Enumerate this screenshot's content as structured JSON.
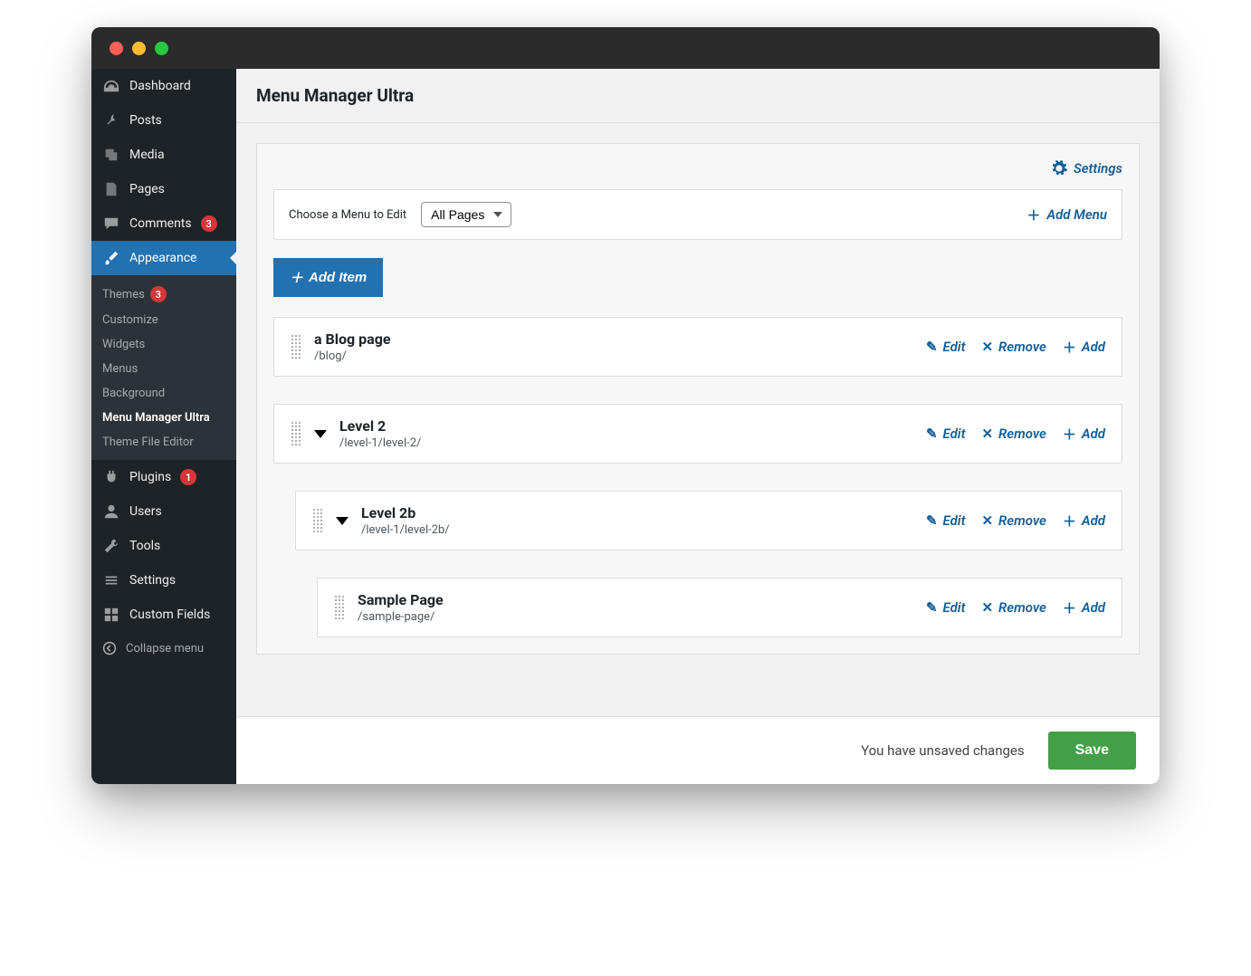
{
  "sidebar": {
    "items": [
      {
        "label": "Dashboard",
        "icon": "dashboard"
      },
      {
        "label": "Posts",
        "icon": "pin"
      },
      {
        "label": "Media",
        "icon": "media"
      },
      {
        "label": "Pages",
        "icon": "pages"
      },
      {
        "label": "Comments",
        "icon": "comment",
        "badge": "3"
      },
      {
        "label": "Appearance",
        "icon": "brush",
        "active": true
      },
      {
        "label": "Plugins",
        "icon": "plug",
        "badge": "1"
      },
      {
        "label": "Users",
        "icon": "user"
      },
      {
        "label": "Tools",
        "icon": "wrench"
      },
      {
        "label": "Settings",
        "icon": "sliders"
      },
      {
        "label": "Custom Fields",
        "icon": "grid"
      }
    ],
    "submenu": [
      {
        "label": "Themes",
        "badge": "3"
      },
      {
        "label": "Customize"
      },
      {
        "label": "Widgets"
      },
      {
        "label": "Menus"
      },
      {
        "label": "Background"
      },
      {
        "label": "Menu Manager Ultra",
        "current": true
      },
      {
        "label": "Theme File Editor"
      }
    ],
    "collapse": "Collapse menu"
  },
  "page": {
    "title": "Menu Manager Ultra",
    "settings_label": "Settings",
    "choose_menu_label": "Choose a Menu to Edit",
    "menu_select_value": "All Pages",
    "add_menu_label": "Add Menu",
    "add_item_label": "Add Item"
  },
  "actions": {
    "edit": "Edit",
    "remove": "Remove",
    "add": "Add"
  },
  "menu_items": [
    {
      "title": "a Blog page",
      "url": "/blog/",
      "indent": 0,
      "expandable": false
    },
    {
      "title": "Level 2",
      "url": "/level-1/level-2/",
      "indent": 0,
      "expandable": true
    },
    {
      "title": "Level 2b",
      "url": "/level-1/level-2b/",
      "indent": 1,
      "expandable": true
    },
    {
      "title": "Sample Page",
      "url": "/sample-page/",
      "indent": 2,
      "expandable": false
    }
  ],
  "footer": {
    "unsaved": "You have unsaved changes",
    "save": "Save"
  }
}
